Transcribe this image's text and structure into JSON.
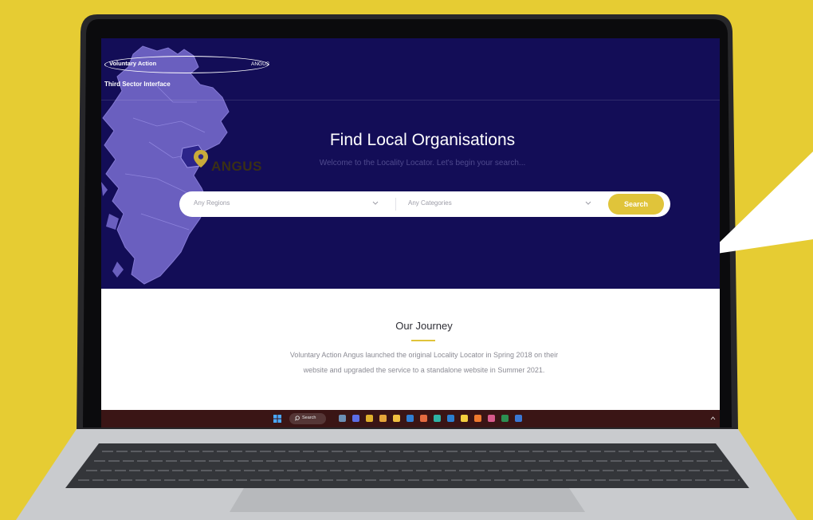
{
  "logo": {
    "org_name": "Voluntary Action",
    "area_name": "ANGUS",
    "subtitle": "Third Sector Interface"
  },
  "hero": {
    "map_label": "ANGUS",
    "title": "Find Local Organisations",
    "subtitle": "Welcome to the Locality Locator. Let's begin your search..."
  },
  "search": {
    "region_placeholder": "Any Regions",
    "category_placeholder": "Any Categories",
    "button_label": "Search"
  },
  "journey": {
    "title": "Our Journey",
    "body": "Voluntary Action Angus launched the original Locality Locator in Spring 2018 on their website and upgraded the service to a standalone website in Summer 2021."
  },
  "taskbar": {
    "search_label": "Search",
    "apps": [
      {
        "icon": "file-explorer-icon",
        "color": "#6b8fb5"
      },
      {
        "icon": "chat-icon",
        "color": "#5c6ee6"
      },
      {
        "icon": "chrome-icon",
        "color": "#e1b12c"
      },
      {
        "icon": "calendar-icon",
        "color": "#e6a63a"
      },
      {
        "icon": "folder-icon",
        "color": "#f0c040"
      },
      {
        "icon": "outlook-icon",
        "color": "#2f7fd4"
      },
      {
        "icon": "paint-icon",
        "color": "#e56b40"
      },
      {
        "icon": "edge-icon",
        "color": "#2fb3a4"
      },
      {
        "icon": "word-icon",
        "color": "#2b7fd0"
      },
      {
        "icon": "sticky-notes-icon",
        "color": "#f4cf3e"
      },
      {
        "icon": "firefox-icon",
        "color": "#ef7a2e"
      },
      {
        "icon": "snipping-tool-icon",
        "color": "#d85a8c"
      },
      {
        "icon": "excel-icon",
        "color": "#2c8f52"
      },
      {
        "icon": "word-doc-icon",
        "color": "#3a78d4"
      }
    ]
  },
  "colors": {
    "background": "#e6cc33",
    "hero": "#130d57",
    "accent": "#e0c43a",
    "map": "#6a5fbf"
  }
}
